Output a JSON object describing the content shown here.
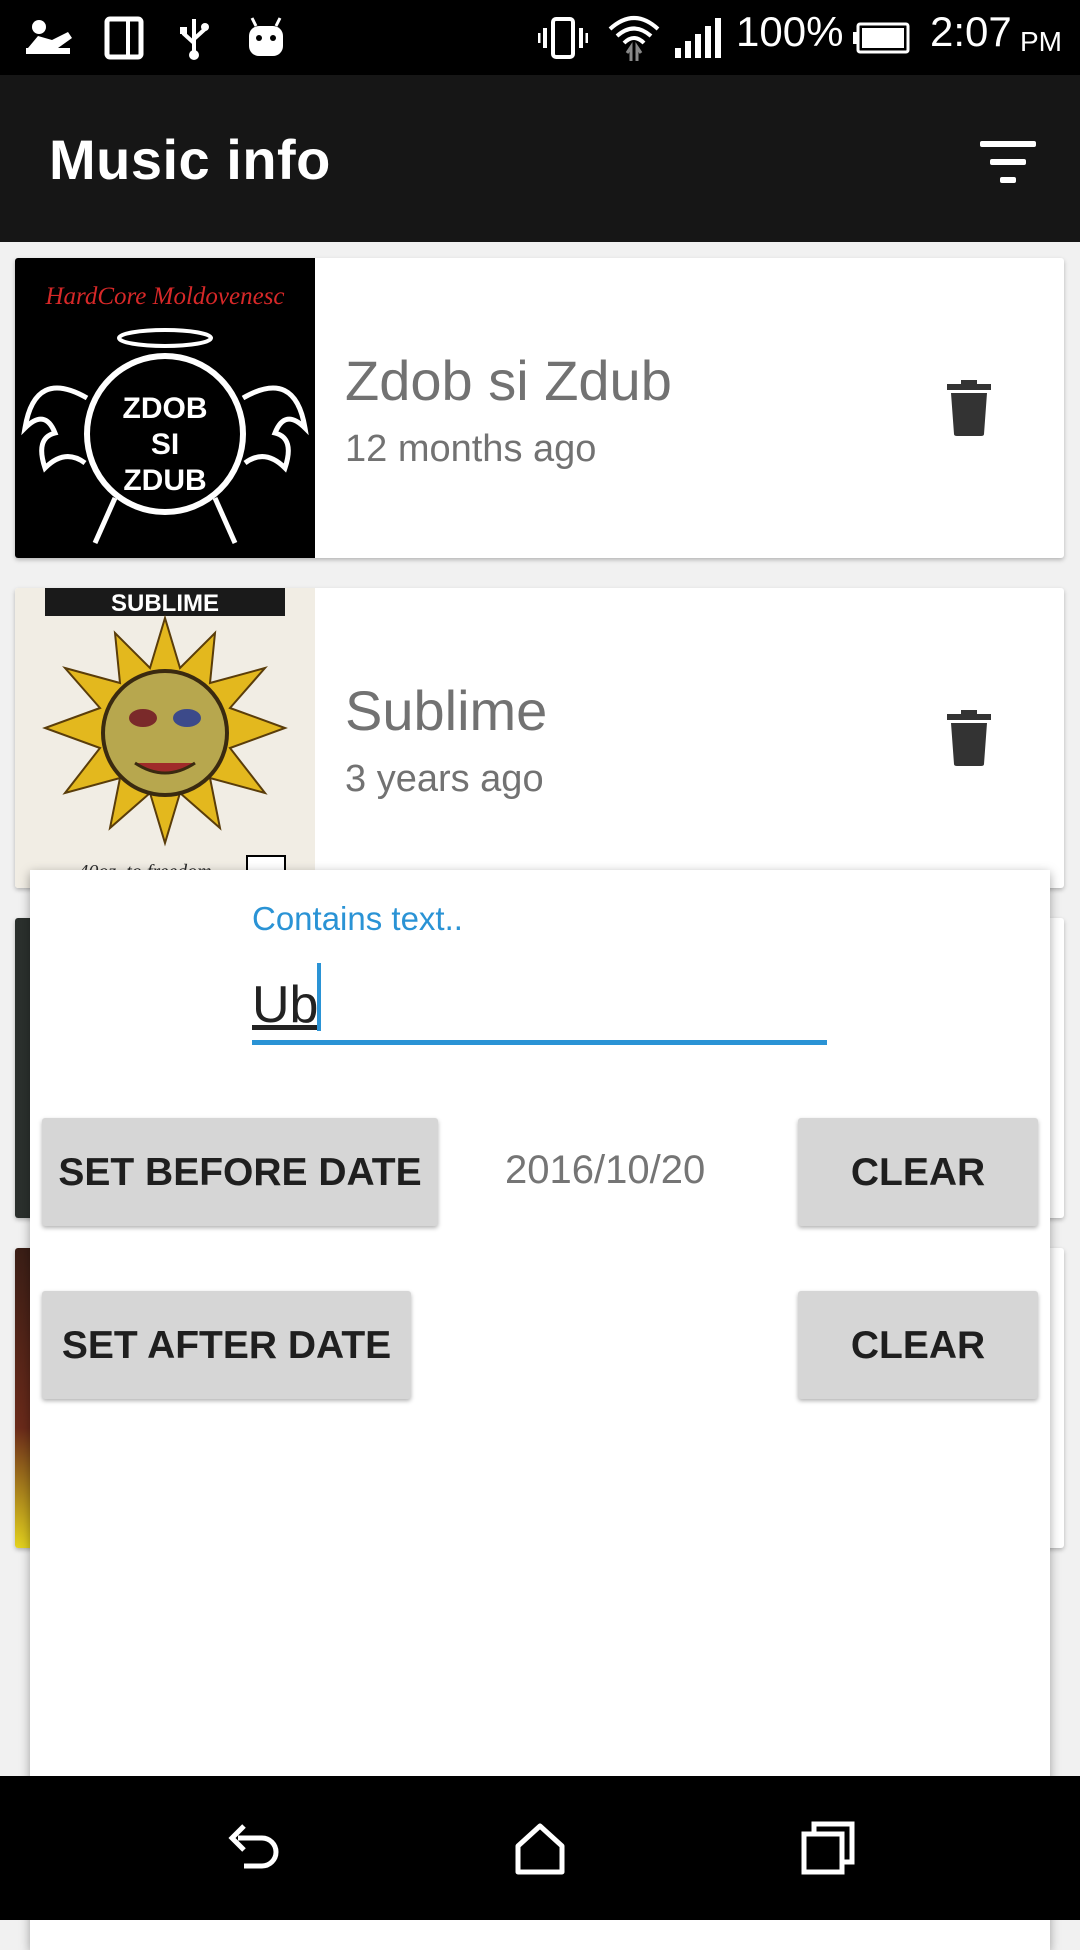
{
  "status_bar": {
    "battery_percent": "100%",
    "time": "2:07",
    "ampm": "PM",
    "icons": [
      "person-icon",
      "phone-icon",
      "usb-icon",
      "android-icon",
      "vibrate-icon",
      "wifi-icon",
      "signal-icon",
      "battery-icon"
    ]
  },
  "toolbar": {
    "title": "Music info",
    "filter_icon": "filter-icon"
  },
  "cards": [
    {
      "title": "Zdob si Zdub",
      "subtitle": "12 months ago",
      "art_text": [
        "HardCore Moldovenesc",
        "ZDOB",
        "SI",
        "ZDUB"
      ],
      "action_icon": "delete-icon"
    },
    {
      "title": "Sublime",
      "subtitle": "3 years ago",
      "art_text": [
        "SUBLIME",
        "40oz. to freedom"
      ],
      "action_icon": "delete-icon"
    }
  ],
  "filter_dialog": {
    "text_label": "Contains text..",
    "text_value": "Ub",
    "set_before_label": "SET BEFORE DATE",
    "before_date": "2016/10/20",
    "clear_before_label": "CLEAR",
    "set_after_label": "SET AFTER DATE",
    "after_date": "",
    "clear_after_label": "CLEAR"
  },
  "nav_bar": {
    "icons": [
      "back-icon",
      "home-icon",
      "recents-icon"
    ]
  },
  "colors": {
    "accent": "#2a93d5",
    "toolbar": "#161616",
    "button": "#d6d6d6"
  }
}
